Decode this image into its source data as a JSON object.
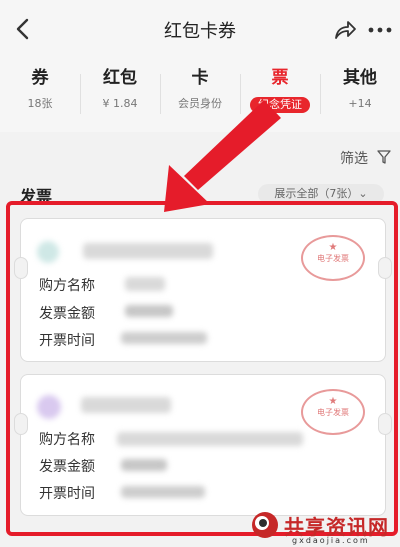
{
  "header": {
    "title": "红包卡券",
    "icons": [
      "back-icon",
      "share-icon",
      "more-icon"
    ]
  },
  "tabs": [
    {
      "label": "券",
      "sub": "18张"
    },
    {
      "label": "红包",
      "sub": "¥ 1.84"
    },
    {
      "label": "卡",
      "sub": "会员身份"
    },
    {
      "label": "票",
      "sub": "纪念凭证",
      "active": true
    },
    {
      "label": "其他",
      "sub": "+14"
    }
  ],
  "filter": {
    "label": "筛选"
  },
  "section": {
    "title": "发票",
    "show_all": "展示全部（7张）⌄"
  },
  "cards": [
    {
      "fields": [
        "购方名称",
        "发票金额",
        "开票时间"
      ],
      "stamp": "电子发票"
    },
    {
      "fields": [
        "购方名称",
        "发票金额",
        "开票时间"
      ],
      "stamp": "电子发票"
    }
  ],
  "watermark": {
    "text": "共享资讯网",
    "url": "gxdaojia.com"
  },
  "colors": {
    "accent": "#e8262c",
    "highlight": "#e51c2a"
  }
}
